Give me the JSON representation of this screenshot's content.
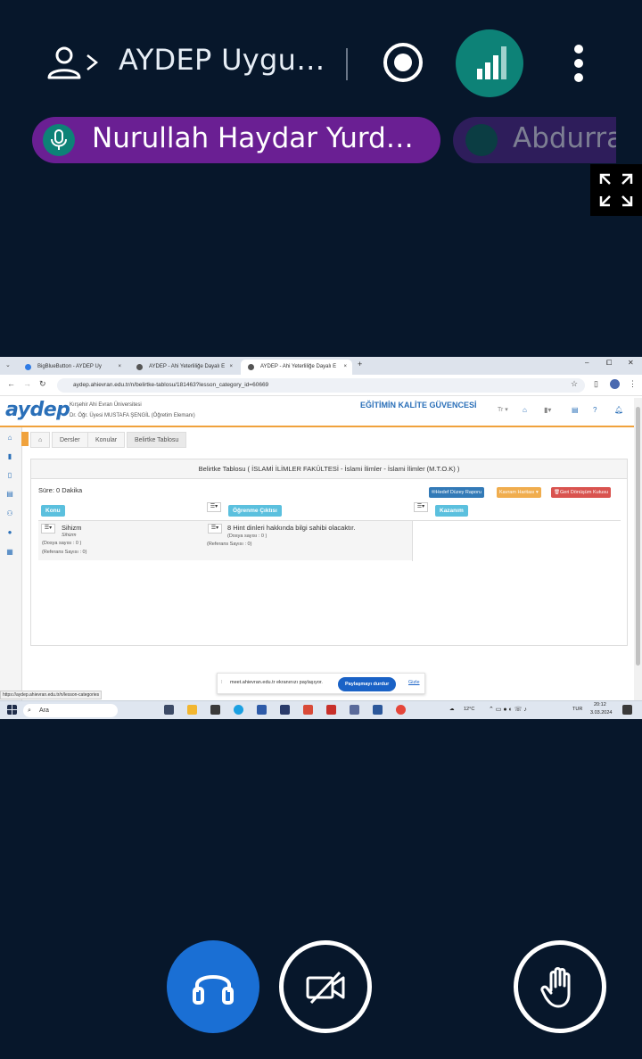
{
  "topbar": {
    "meeting_title": "AYDEP Uygu…",
    "icons": {
      "user": "user-icon",
      "chevron": "chevron-right-icon",
      "record": "record-icon",
      "connection": "connection-status-icon",
      "more": "more-vertical-icon"
    },
    "accent_color": "#0d8277"
  },
  "talkers": [
    {
      "name": "Nurullah Haydar Yurd…",
      "icon": "microphone-icon",
      "color": "#6a1f93"
    },
    {
      "name": "Abdurra",
      "icon": "muted-avatar",
      "color": "#2e1d5b"
    }
  ],
  "fullscreen": {
    "icon": "fullscreen-icon"
  },
  "screenshare": {
    "browser": {
      "tabs": [
        {
          "label": "BigBlueButton - AYDEP Uy",
          "close": "×"
        },
        {
          "label": "AYDEP - Ahi Yeterliliğe Dayalı E",
          "close": "×"
        },
        {
          "label": "AYDEP - Ahi Yeterliliğe Dayalı E",
          "close": "×"
        }
      ],
      "new_tab": "+",
      "window_controls": [
        "–",
        "⧠",
        "✕"
      ],
      "url": "aydep.ahievran.edu.tr/n/belirtke-tablosu/181463?lesson_category_id=60669"
    },
    "site": {
      "logo": "aydep",
      "university": "Kırşehir Ahi Evran Üniversitesi",
      "user": "Dr. Öğr. Üyesi MUSTAFA ŞENGİL (Öğretim Elemanı)",
      "banner": "EĞİTİMİN KALİTE GÜVENCESİ",
      "lang": "Tr ▾",
      "breadcrumb": [
        "Dersler",
        "Konular",
        "Belirtke Tablosu"
      ],
      "panel_title": "Belirtke Tablosu ( İSLAMİ İLİMLER FAKÜLTESİ - İslami İlimler - İslami İlimler (M.T.O.K) )",
      "sure": "Süre: 0 Dakika",
      "buttons": {
        "hedef": "✉Hedef Düzey Raporu",
        "kavram": "Kavram Haritası ▾",
        "geri": "🗑Geri Dönüşüm Kutusu"
      },
      "columns": [
        "Konu",
        "Öğrenme Çıktısı",
        "Kazanım"
      ],
      "menu_glyph": "☰▾",
      "row": {
        "topic": "Sihizm",
        "topic_sub": "Sihizm",
        "topic_dosya": "(Dosya sayısı : 0 )",
        "topic_referans": "(Referans Sayısı : 0)",
        "outcome": "8 Hint dinleri hakkında bilgi sahibi olacaktır.",
        "outcome_dosya": "(Dosya sayısı : 0 )",
        "outcome_referans": "(Referans Sayısı : 0)"
      }
    },
    "share_bar": {
      "message": "meet.ahievran.edu.tr ekranınızı paylaşıyor.",
      "stop_label": "Paylaşmayı durdur",
      "hide_label": "Gizle"
    },
    "status_url": "https://aydep.ahievran.edu.tr/n/lesson-categories",
    "taskbar": {
      "search_placeholder": "Ara",
      "weather": "12°C",
      "lang": "TUR",
      "time": "20:12",
      "date": "3.03.2024"
    }
  },
  "controls": {
    "audio": "headphones-icon",
    "video": "camera-off-icon",
    "hand": "raise-hand-icon",
    "audio_color": "#1a6fd4"
  }
}
